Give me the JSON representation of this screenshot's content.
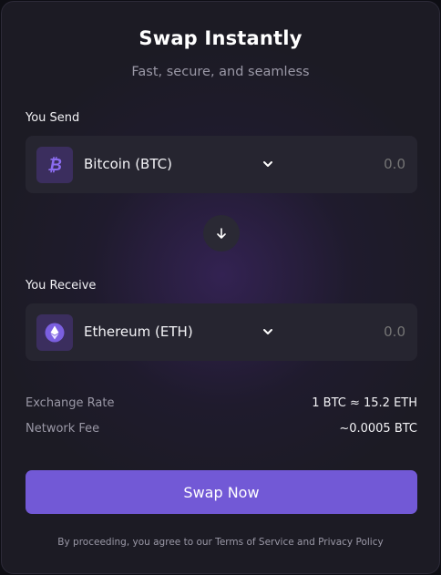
{
  "header": {
    "title": "Swap Instantly",
    "subtitle": "Fast, secure, and seamless"
  },
  "send": {
    "label": "You Send",
    "token_name": "Bitcoin (BTC)",
    "token_icon": "bitcoin-icon",
    "amount_placeholder": "0.0"
  },
  "receive": {
    "label": "You Receive",
    "token_name": "Ethereum (ETH)",
    "token_icon": "ethereum-icon",
    "amount_placeholder": "0.0"
  },
  "info": {
    "rate_label": "Exchange Rate",
    "rate_value": "1 BTC ≈ 15.2 ETH",
    "fee_label": "Network Fee",
    "fee_value": "~0.0005 BTC"
  },
  "action": {
    "swap_label": "Swap Now"
  },
  "footer": {
    "text": "By proceeding, you agree to our Terms of Service and Privacy Policy"
  },
  "colors": {
    "accent": "#7259d6",
    "background": "#1c1b24",
    "field": "#262530",
    "icon_bg": "#3b2e5e"
  }
}
